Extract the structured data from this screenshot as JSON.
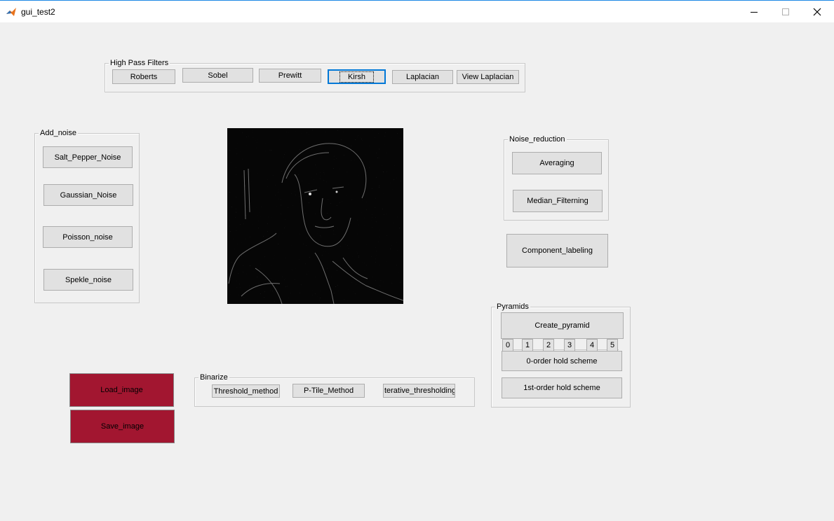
{
  "window": {
    "title": "gui_test2",
    "app_icon": "matlab-icon",
    "controls": {
      "minimize": "minimize-icon",
      "maximize": "maximize-icon",
      "close": "close-icon"
    }
  },
  "high_pass_filters": {
    "title": "High Pass Filters",
    "buttons": [
      "Roberts",
      "Sobel",
      "Prewitt",
      "Kirsh",
      "Laplacian",
      "View Laplacian"
    ]
  },
  "add_noise": {
    "title": "Add_noise",
    "buttons": [
      "Salt_Pepper_Noise",
      "Gaussian_Noise",
      "Poisson_noise",
      "Spekle_noise"
    ]
  },
  "noise_reduction": {
    "title": "Noise_reduction",
    "buttons": [
      "Averaging",
      "Median_Filterning"
    ]
  },
  "component_labeling": {
    "label": "Component_labeling"
  },
  "pyramids": {
    "title": "Pyramids",
    "create_label": "Create_pyramid",
    "levels": [
      "0",
      "1",
      "2",
      "3",
      "4",
      "5"
    ],
    "zero_order_label": "0-order hold scheme",
    "first_order_label": "1st-order hold scheme"
  },
  "binarize": {
    "title": "Binarize",
    "buttons": [
      "Threshold_method",
      "P-Tile_Method",
      "Iterative_thresholding"
    ]
  },
  "file_buttons": {
    "load": "Load_image",
    "save": "Save_image",
    "color": "#a21630"
  },
  "image_display": {
    "content": "edge-filtered grayscale portrait"
  }
}
